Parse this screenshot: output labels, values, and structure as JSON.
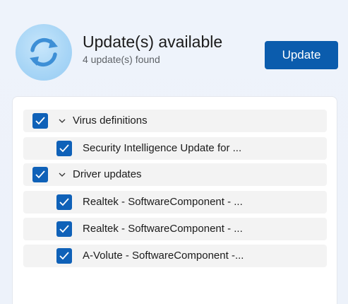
{
  "header": {
    "title": "Update(s) available",
    "subtitle": "4 update(s) found",
    "update_button": "Update"
  },
  "icons": {
    "status": "sync-icon",
    "expand": "chevron-down-icon",
    "check": "checkmark-icon"
  },
  "colors": {
    "accent": "#0b5cad",
    "checkbox": "#0f61b8",
    "badge": "#a9d6f6",
    "sync_arrows": "#3d8fd6"
  },
  "groups": [
    {
      "label": "Virus definitions",
      "checked": true,
      "expanded": true,
      "items": [
        {
          "label": "Security Intelligence Update for ...",
          "checked": true
        }
      ]
    },
    {
      "label": "Driver updates",
      "checked": true,
      "expanded": true,
      "items": [
        {
          "label": "Realtek - SoftwareComponent - ...",
          "checked": true
        },
        {
          "label": "Realtek - SoftwareComponent - ...",
          "checked": true
        },
        {
          "label": "A-Volute - SoftwareComponent -...",
          "checked": true
        }
      ]
    }
  ]
}
